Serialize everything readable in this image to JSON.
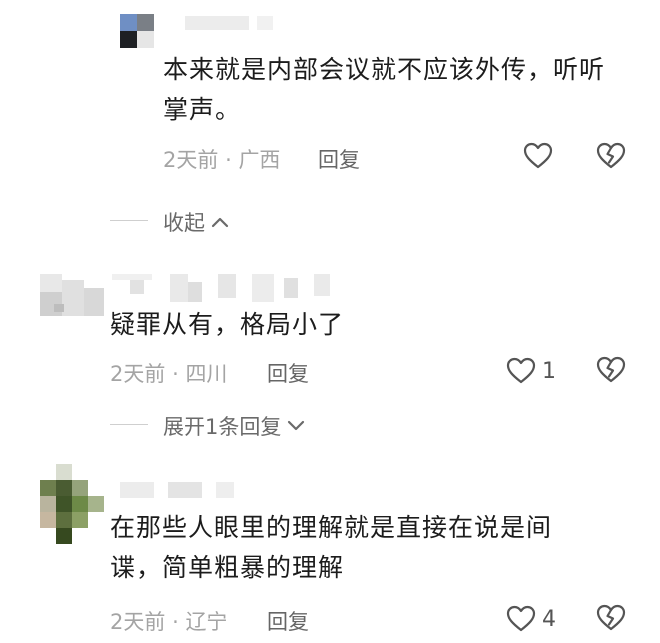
{
  "comments": [
    {
      "text_lines": [
        "本来就是内部会议就不应该外传，听听",
        "掌声。"
      ],
      "time": "2天前",
      "separator": "·",
      "location": "广西",
      "reply_label": "回复",
      "like_count": "",
      "fold_label": "收起"
    },
    {
      "text_lines": [
        "疑罪从有，格局小了"
      ],
      "time": "2天前",
      "separator": "·",
      "location": "四川",
      "reply_label": "回复",
      "like_count": "1",
      "fold_label": "展开1条回复"
    },
    {
      "text_lines": [
        "在那些人眼里的理解就是直接在说是间",
        "谍，简单粗暴的理解"
      ],
      "time": "2天前",
      "separator": "·",
      "location": "辽宁",
      "reply_label": "回复",
      "like_count": "4"
    }
  ],
  "icons": {
    "like": "heart-outline-icon",
    "dislike": "broken-heart-icon",
    "collapse": "chevron-up-icon",
    "expand": "chevron-down-icon"
  },
  "colors": {
    "text": "#1c1c1c",
    "meta": "#a4a4a4",
    "icon": "#555555"
  }
}
